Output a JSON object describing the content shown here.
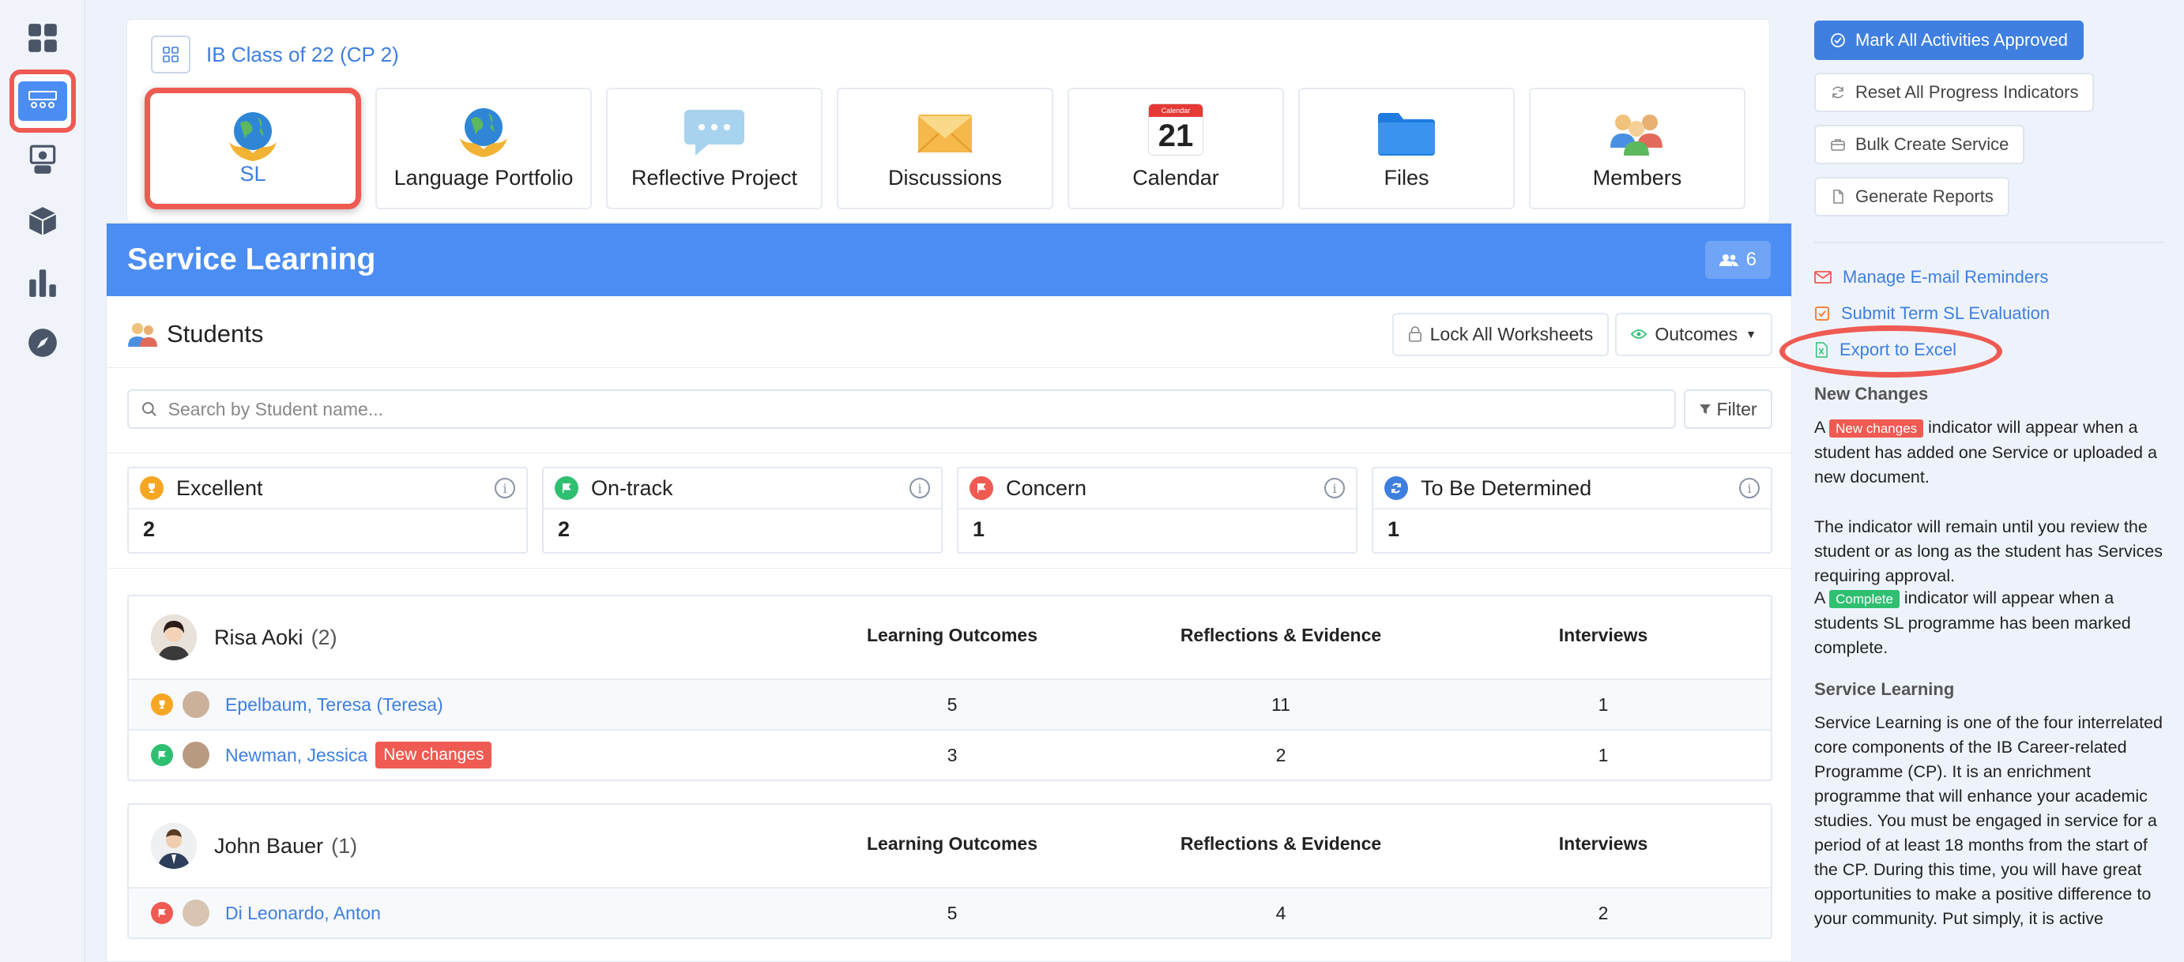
{
  "rail": {
    "items": [
      {
        "name": "dashboard"
      },
      {
        "name": "classes"
      },
      {
        "name": "teacher"
      },
      {
        "name": "cube"
      },
      {
        "name": "chart"
      },
      {
        "name": "compass"
      }
    ]
  },
  "topbar": {
    "class_name": "IB Class of 22 (CP 2)",
    "tiles": [
      {
        "label": "SL"
      },
      {
        "label": "Language Portfolio"
      },
      {
        "label": "Reflective Project"
      },
      {
        "label": "Discussions"
      },
      {
        "label": "Calendar",
        "calendar_month": "Calendar",
        "calendar_day": "21"
      },
      {
        "label": "Files"
      },
      {
        "label": "Members"
      }
    ]
  },
  "main": {
    "title": "Service Learning",
    "member_count": "6",
    "students_title": "Students",
    "lock_label": "Lock All Worksheets",
    "outcomes_label": "Outcomes",
    "search_placeholder": "Search by Student name...",
    "filter_label": "Filter",
    "status_cards": [
      {
        "label": "Excellent",
        "value": "2",
        "color": "#f5a623"
      },
      {
        "label": "On-track",
        "value": "2",
        "color": "#2fbf71"
      },
      {
        "label": "Concern",
        "value": "1",
        "color": "#ef5a52"
      },
      {
        "label": "To Be Determined",
        "value": "1",
        "color": "#3e7fe0"
      }
    ],
    "columns": [
      "Learning Outcomes",
      "Reflections & Evidence",
      "Interviews"
    ],
    "groups": [
      {
        "advisor": "Risa Aoki",
        "count": "(2)",
        "students": [
          {
            "name": "Epelbaum, Teresa (Teresa)",
            "status": "excellent",
            "outcomes": "5",
            "reflections": "11",
            "interviews": "1",
            "badge": ""
          },
          {
            "name": "Newman, Jessica",
            "status": "on-track",
            "outcomes": "3",
            "reflections": "2",
            "interviews": "1",
            "badge": "New changes"
          }
        ]
      },
      {
        "advisor": "John Bauer",
        "count": "(1)",
        "students": [
          {
            "name": "Di Leonardo, Anton",
            "status": "concern",
            "outcomes": "5",
            "reflections": "4",
            "interviews": "2",
            "badge": ""
          }
        ]
      }
    ]
  },
  "sidebar": {
    "mark_approved": "Mark All Activities Approved",
    "reset_progress": "Reset All Progress Indicators",
    "bulk_create": "Bulk Create Service",
    "generate_reports": "Generate Reports",
    "manage_reminders": "Manage E-mail Reminders",
    "submit_eval": "Submit Term SL Evaluation",
    "export_excel": "Export to Excel",
    "new_changes_heading": "New Changes",
    "p1_a": "A",
    "p1_tag": "New changes",
    "p1_b": "indicator will appear when a student has added one Service or uploaded a new document.",
    "p2": "The indicator will remain until you review the student or as long as the student has Services requiring approval.",
    "p3_a": "A",
    "p3_tag": "Complete",
    "p3_b": "indicator will appear when a students SL programme has been marked complete.",
    "sl_heading": "Service Learning",
    "sl_text": "Service Learning is one of the four interrelated core components of the IB Career-related Programme (CP). It is an enrichment programme that will enhance your academic studies. You must be engaged in service for a period of at least 18 months from the start of the CP. During this time, you will have great opportunities to make a positive difference to your community. Put simply, it is active"
  }
}
